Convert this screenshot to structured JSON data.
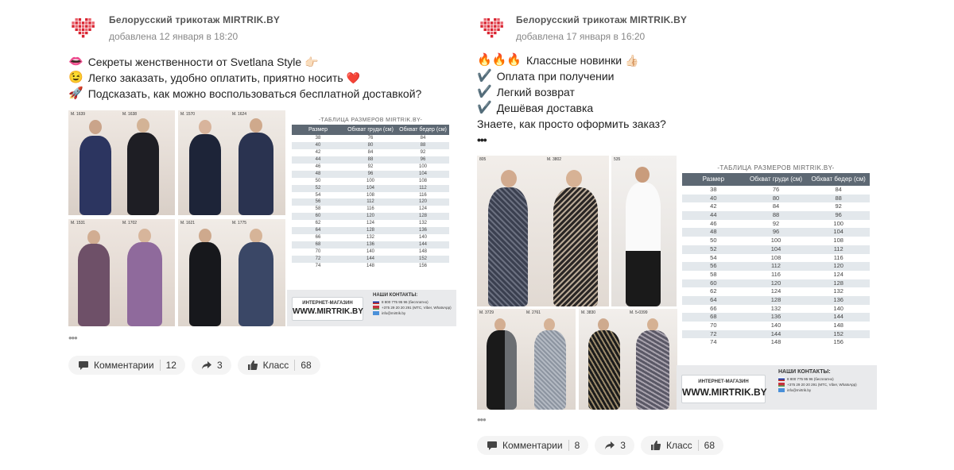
{
  "posts": [
    {
      "author": "Белорусский трикотаж MIRTRIK.BY",
      "added": "добавлена 12 января в 18:20",
      "lines": [
        {
          "emoji": "👄",
          "text": "Секреты женственности от Svetlana Style 👉🏻"
        },
        {
          "emoji": "😉",
          "text": "Легко заказать, удобно оплатить, приятно носить ❤️"
        },
        {
          "emoji": "🚀",
          "text": "Подсказать, как можно воспользоваться бесплатной доставкой?"
        }
      ],
      "more": "•••",
      "comments_label": "Комментарии",
      "comments_count": "12",
      "share_count": "3",
      "like_label": "Класс",
      "like_count": "68"
    },
    {
      "author": "Белорусский трикотаж MIRTRIK.BY",
      "added": "добавлена 17 января в 16:20",
      "lines": [
        {
          "emoji": "🔥🔥🔥",
          "text": "Классные новинки 👍🏻"
        },
        {
          "emoji": "✔️",
          "text": "Оплата при получении"
        },
        {
          "emoji": "✔️",
          "text": "Легкий возврат"
        },
        {
          "emoji": "✔️",
          "text": "Дешёвая доставка"
        },
        {
          "emoji": "",
          "text": "Знаете, как просто оформить заказ?"
        }
      ],
      "more": "•••",
      "more_text": "•••",
      "comments_label": "Комментарии",
      "comments_count": "8",
      "share_count": "3",
      "like_label": "Класс",
      "like_count": "68"
    }
  ],
  "size_table": {
    "title": "-ТАБЛИЦА РАЗМЕРОВ MIRTRIK.BY-",
    "headers": [
      "Размер",
      "Обхват груди (см)",
      "Обхват бедер (см)"
    ],
    "rows": [
      [
        "38",
        "76",
        "84"
      ],
      [
        "40",
        "80",
        "88"
      ],
      [
        "42",
        "84",
        "92"
      ],
      [
        "44",
        "88",
        "96"
      ],
      [
        "46",
        "92",
        "100"
      ],
      [
        "48",
        "96",
        "104"
      ],
      [
        "50",
        "100",
        "108"
      ],
      [
        "52",
        "104",
        "112"
      ],
      [
        "54",
        "108",
        "116"
      ],
      [
        "56",
        "112",
        "120"
      ],
      [
        "58",
        "116",
        "124"
      ],
      [
        "60",
        "120",
        "128"
      ],
      [
        "62",
        "124",
        "132"
      ],
      [
        "64",
        "128",
        "136"
      ],
      [
        "66",
        "132",
        "140"
      ],
      [
        "68",
        "136",
        "144"
      ],
      [
        "70",
        "140",
        "148"
      ],
      [
        "72",
        "144",
        "152"
      ],
      [
        "74",
        "148",
        "156"
      ]
    ],
    "shop_line1": "ИНТЕРНЕТ-МАГАЗИН",
    "shop_line2": "WWW.MIRTRIK.BY",
    "contacts_title": "НАШИ КОНТАКТЫ:",
    "contacts": [
      "8 800 775 95 96 (бесплатно)",
      "+375 29 20 20 291 (МТС, Viber, WhatsApp)",
      "info@mirtrik.by"
    ]
  },
  "photo_codes_left": [
    "М. 1639",
    "М. 1638",
    "М. 1570",
    "М. 1624",
    "М. 1531",
    "М. 1702",
    "М. 1621",
    "М. 1775"
  ],
  "photo_codes_right": [
    "805",
    "М. 3802",
    "535",
    "М. 3729",
    "М. 2761",
    "М. 3830",
    "М. 5-0399"
  ],
  "colors": {
    "brand_red": "#d8232f",
    "table_header": "#5d6873",
    "pill_bg": "#f4f4f4"
  }
}
